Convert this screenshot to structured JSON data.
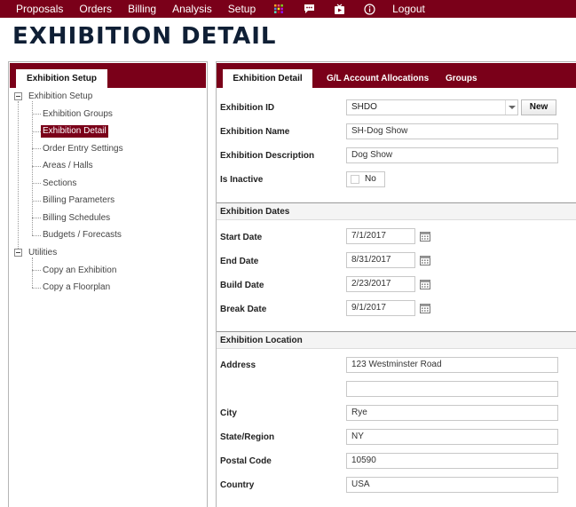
{
  "nav": {
    "items": [
      "Proposals",
      "Orders",
      "Billing",
      "Analysis",
      "Setup"
    ],
    "icons": [
      "grid-icon",
      "chat-icon",
      "tv-icon",
      "info-icon"
    ],
    "logout": "Logout",
    "bar_color": "#7a0019"
  },
  "page": {
    "title": "EXHIBITION DETAIL"
  },
  "left": {
    "tab": "Exhibition Setup",
    "tree": {
      "root1": "Exhibition Setup",
      "children1": [
        "Exhibition Groups",
        "Exhibition Detail",
        "Order Entry Settings",
        "Areas / Halls",
        "Sections",
        "Billing Parameters",
        "Billing Schedules",
        "Budgets / Forecasts"
      ],
      "selected_index": 1,
      "root2": "Utilities",
      "children2": [
        "Copy an Exhibition",
        "Copy a Floorplan"
      ]
    }
  },
  "right": {
    "tabs": [
      "Exhibition Detail",
      "G/L Account Allocations",
      "Groups"
    ],
    "active_tab": 0,
    "general": {
      "exhibition_id_label": "Exhibition ID",
      "exhibition_id_value": "SHDO",
      "new_button": "New",
      "name_label": "Exhibition Name",
      "name_value": "SH-Dog Show",
      "desc_label": "Exhibition Description",
      "desc_value": "Dog Show",
      "inactive_label": "Is Inactive",
      "inactive_value": "No"
    },
    "dates": {
      "heading": "Exhibition Dates",
      "start_label": "Start Date",
      "start_value": "7/1/2017",
      "end_label": "End Date",
      "end_value": "8/31/2017",
      "build_label": "Build Date",
      "build_value": "2/23/2017",
      "break_label": "Break Date",
      "break_value": "9/1/2017"
    },
    "location": {
      "heading": "Exhibition Location",
      "address_label": "Address",
      "address1_value": "123 Westminster Road",
      "address2_value": "",
      "city_label": "City",
      "city_value": "Rye",
      "state_label": "State/Region",
      "state_value": "NY",
      "postal_label": "Postal Code",
      "postal_value": "10590",
      "country_label": "Country",
      "country_value": "USA"
    }
  }
}
